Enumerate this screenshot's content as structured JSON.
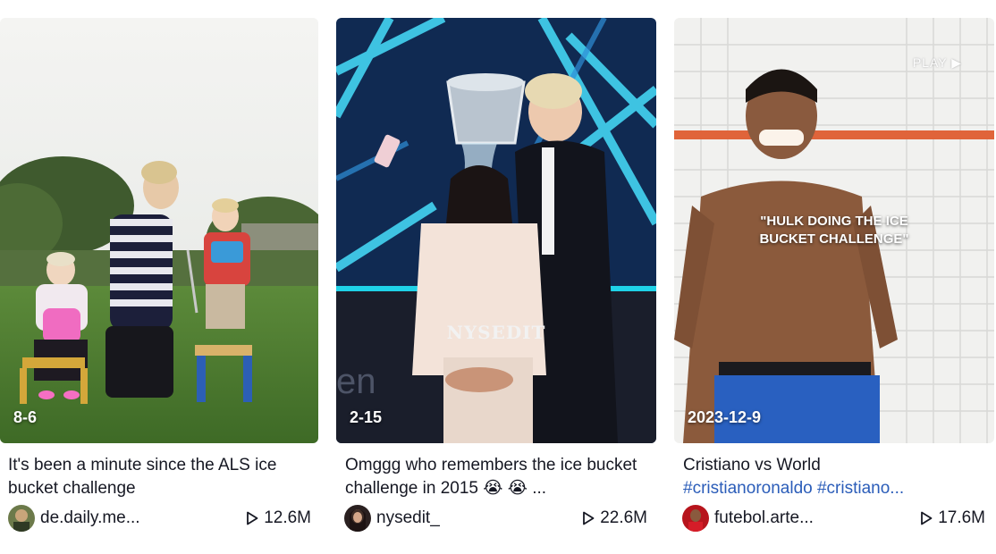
{
  "videos": [
    {
      "date": "8-6",
      "caption": "It's been a minute since the ALS ice bucket challenge",
      "author": "de.daily.me...",
      "views": "12.6M",
      "thumbnail": "family-backyard-ice-bucket"
    },
    {
      "date": "2-15",
      "caption_text": "Omggg who remembers the ice bucket challenge in 2015 ",
      "caption_emoji": "😭 😭 ...",
      "watermark": "NYSEDIT",
      "author": "nysedit_",
      "views": "22.6M",
      "thumbnail": "talk-show-ice-bucket"
    },
    {
      "date": "2023-12-9",
      "caption_line1": "Cristiano vs World",
      "caption_tags": "#cristianoronaldo #cristiano...",
      "overlay_text_1": "\"HULK DOING THE ICE",
      "overlay_text_2": "BUCKET CHALLENGE\"",
      "play_text": "PLAY ▶",
      "author": "futebol.arte...",
      "views": "17.6M",
      "thumbnail": "shower-ice-bucket"
    }
  ],
  "icons": {
    "play": "play-outline-icon"
  },
  "colors": {
    "hashtag": "#2b5db9",
    "text": "#161823"
  }
}
